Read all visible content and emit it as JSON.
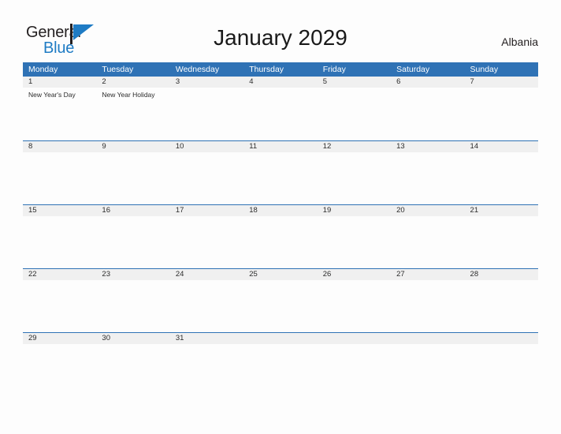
{
  "brand": {
    "name_part1": "General",
    "name_part2": "Blue",
    "flag_icon": "blue-flag-icon",
    "primary_color": "#2f72b5",
    "logo_blue": "#1e7bc4",
    "logo_dark": "#231f20"
  },
  "header": {
    "title": "January 2029",
    "country": "Albania"
  },
  "calendar": {
    "weekdays": [
      "Monday",
      "Tuesday",
      "Wednesday",
      "Thursday",
      "Friday",
      "Saturday",
      "Sunday"
    ],
    "header_bg": "#2f72b5",
    "date_band_bg": "#f0f0f0",
    "row_divider_color": "#2f72b5",
    "weeks": [
      {
        "days": [
          {
            "date": "1",
            "events": [
              "New Year's Day"
            ]
          },
          {
            "date": "2",
            "events": [
              "New Year Holiday"
            ]
          },
          {
            "date": "3",
            "events": []
          },
          {
            "date": "4",
            "events": []
          },
          {
            "date": "5",
            "events": []
          },
          {
            "date": "6",
            "events": []
          },
          {
            "date": "7",
            "events": []
          }
        ]
      },
      {
        "days": [
          {
            "date": "8",
            "events": []
          },
          {
            "date": "9",
            "events": []
          },
          {
            "date": "10",
            "events": []
          },
          {
            "date": "11",
            "events": []
          },
          {
            "date": "12",
            "events": []
          },
          {
            "date": "13",
            "events": []
          },
          {
            "date": "14",
            "events": []
          }
        ]
      },
      {
        "days": [
          {
            "date": "15",
            "events": []
          },
          {
            "date": "16",
            "events": []
          },
          {
            "date": "17",
            "events": []
          },
          {
            "date": "18",
            "events": []
          },
          {
            "date": "19",
            "events": []
          },
          {
            "date": "20",
            "events": []
          },
          {
            "date": "21",
            "events": []
          }
        ]
      },
      {
        "days": [
          {
            "date": "22",
            "events": []
          },
          {
            "date": "23",
            "events": []
          },
          {
            "date": "24",
            "events": []
          },
          {
            "date": "25",
            "events": []
          },
          {
            "date": "26",
            "events": []
          },
          {
            "date": "27",
            "events": []
          },
          {
            "date": "28",
            "events": []
          }
        ]
      },
      {
        "days": [
          {
            "date": "29",
            "events": []
          },
          {
            "date": "30",
            "events": []
          },
          {
            "date": "31",
            "events": []
          },
          {
            "date": "",
            "events": []
          },
          {
            "date": "",
            "events": []
          },
          {
            "date": "",
            "events": []
          },
          {
            "date": "",
            "events": []
          }
        ]
      }
    ]
  }
}
